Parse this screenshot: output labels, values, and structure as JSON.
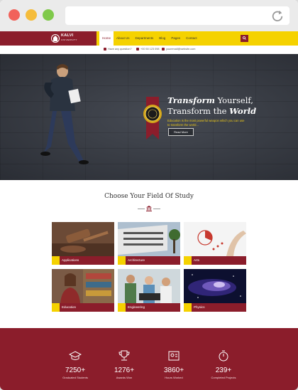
{
  "header": {
    "logo_name": "KALVI",
    "logo_sub": "UNIVERSITY",
    "nav": [
      "Home",
      "About Us",
      "Departments",
      "Blog",
      "Pages",
      "Contact"
    ],
    "active_nav": "Home"
  },
  "contact": {
    "address": "Have any question?",
    "phone": "+00 50 123 098",
    "email": "youremail@website.com"
  },
  "hero": {
    "title_line1_em": "Transform",
    "title_line1_rest": " Yourself,",
    "title_line2_rest": "Transform the ",
    "title_line2_em": "World",
    "subtitle": "Education is the most powerful weapon which you can use to transform the world...",
    "button": "Read More"
  },
  "fields": {
    "title": "Choose Your Field Of Study",
    "cards": [
      {
        "label": "Applications"
      },
      {
        "label": "Architecture"
      },
      {
        "label": "Arts"
      },
      {
        "label": "Education"
      },
      {
        "label": "Engineering"
      },
      {
        "label": "Physics"
      }
    ]
  },
  "stats": [
    {
      "value": "7250+",
      "label": "Graduated Students",
      "icon": "graduation-cap-icon"
    },
    {
      "value": "1276+",
      "label": "Awards Won",
      "icon": "trophy-icon"
    },
    {
      "value": "3860+",
      "label": "Hours Worked",
      "icon": "id-card-icon"
    },
    {
      "value": "239+",
      "label": "Completed Projects",
      "icon": "stopwatch-icon"
    }
  ],
  "colors": {
    "brand": "#8b1d2b",
    "accent": "#f5d200"
  }
}
